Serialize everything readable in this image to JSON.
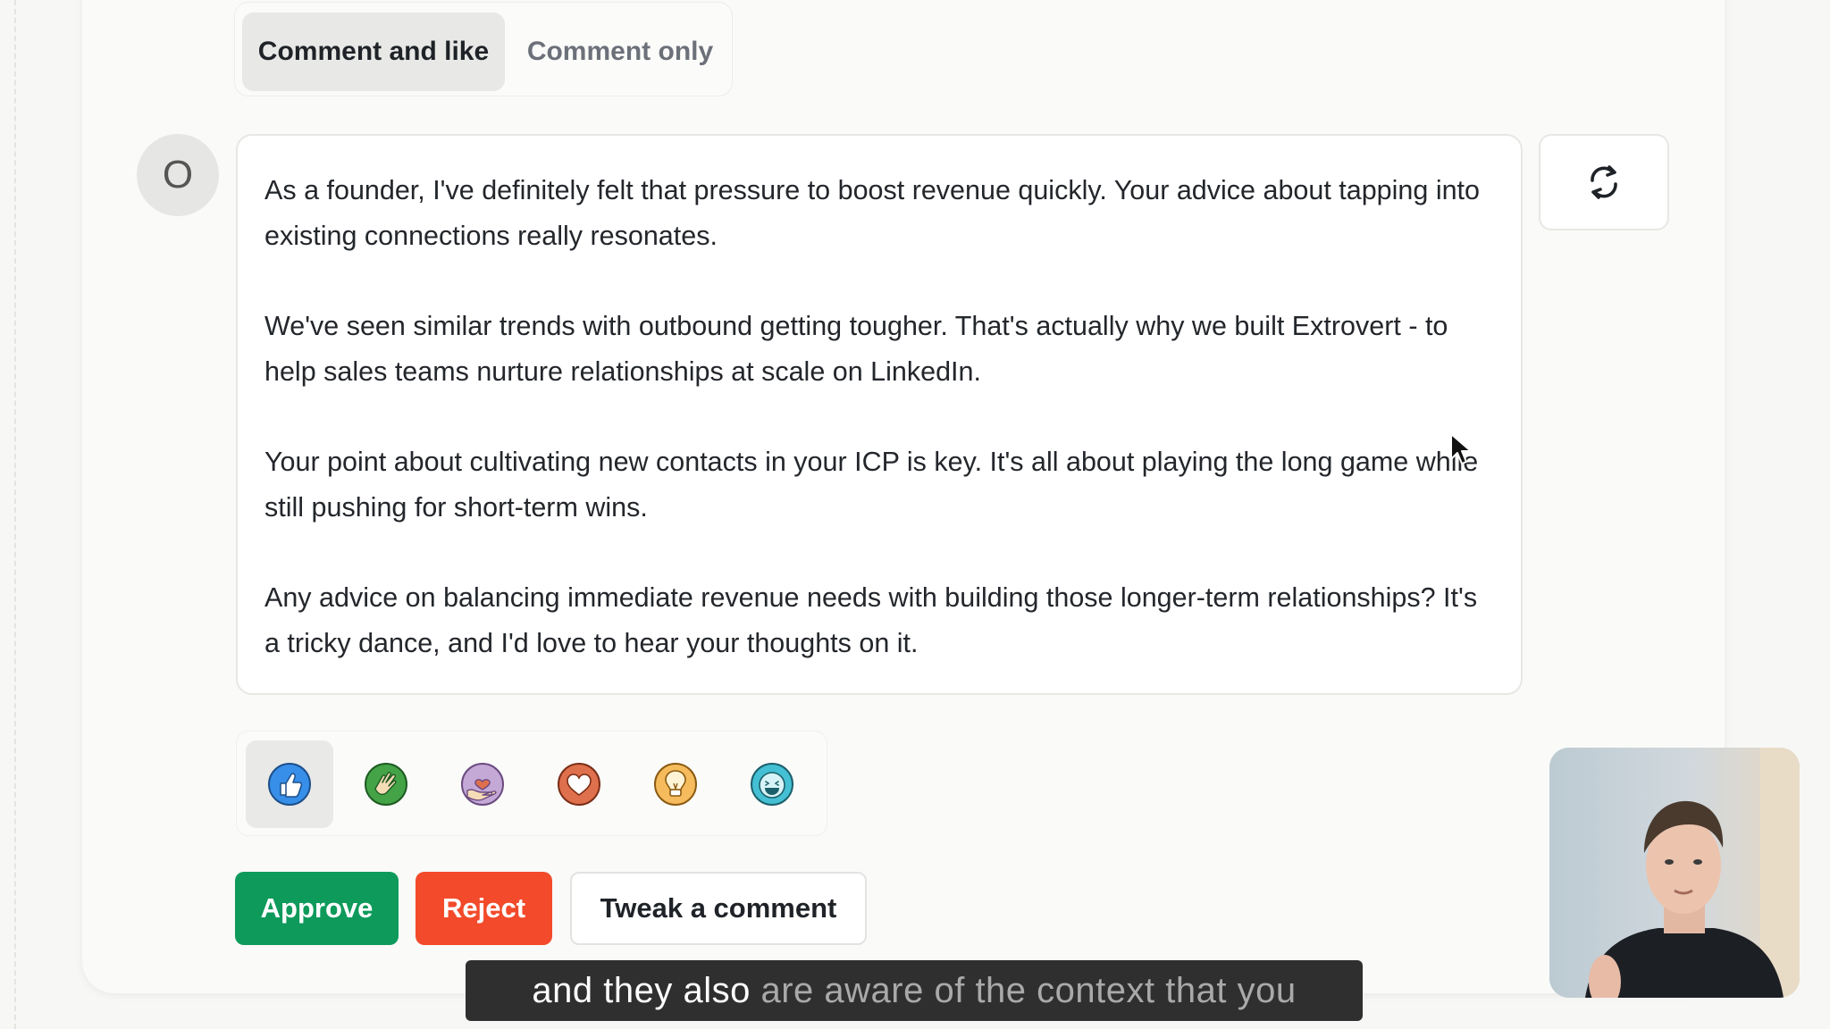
{
  "mode_tabs": [
    {
      "label": "Comment and like",
      "active": true
    },
    {
      "label": "Comment only",
      "active": false
    }
  ],
  "author": {
    "avatar_initial": "O"
  },
  "comment": {
    "paragraphs": [
      "As a founder, I've definitely felt that pressure to boost revenue quickly. Your advice about tapping into existing connections really resonates.",
      "We've seen similar trends with outbound getting tougher. That's actually why we built Extrovert - to help sales teams nurture relationships at scale on LinkedIn.",
      "Your point about cultivating new contacts in your ICP is key. It's all about playing the long game while still pushing for short-term wins.",
      "Any advice on balancing immediate revenue needs with building those longer-term relationships? It's a tricky dance, and I'd love to hear your thoughts on it."
    ]
  },
  "regenerate": {
    "icon": "refresh-icon"
  },
  "reactions": [
    {
      "icon": "like-icon",
      "color": "#378fe9",
      "selected": true
    },
    {
      "icon": "celebrate-icon",
      "color": "#44a346",
      "selected": false
    },
    {
      "icon": "support-icon",
      "color": "#c4a8d6",
      "selected": false
    },
    {
      "icon": "love-icon",
      "color": "#df704d",
      "selected": false
    },
    {
      "icon": "insightful-icon",
      "color": "#f5bb5c",
      "selected": false
    },
    {
      "icon": "funny-icon",
      "color": "#44bfd3",
      "selected": false
    }
  ],
  "actions": {
    "approve": "Approve",
    "reject": "Reject",
    "tweak": "Tweak a comment"
  },
  "colors": {
    "approve": "#0e9a5b",
    "reject": "#f24a2a"
  },
  "caption": {
    "spoken": "and they also",
    "pending": " are aware of the context that you"
  }
}
